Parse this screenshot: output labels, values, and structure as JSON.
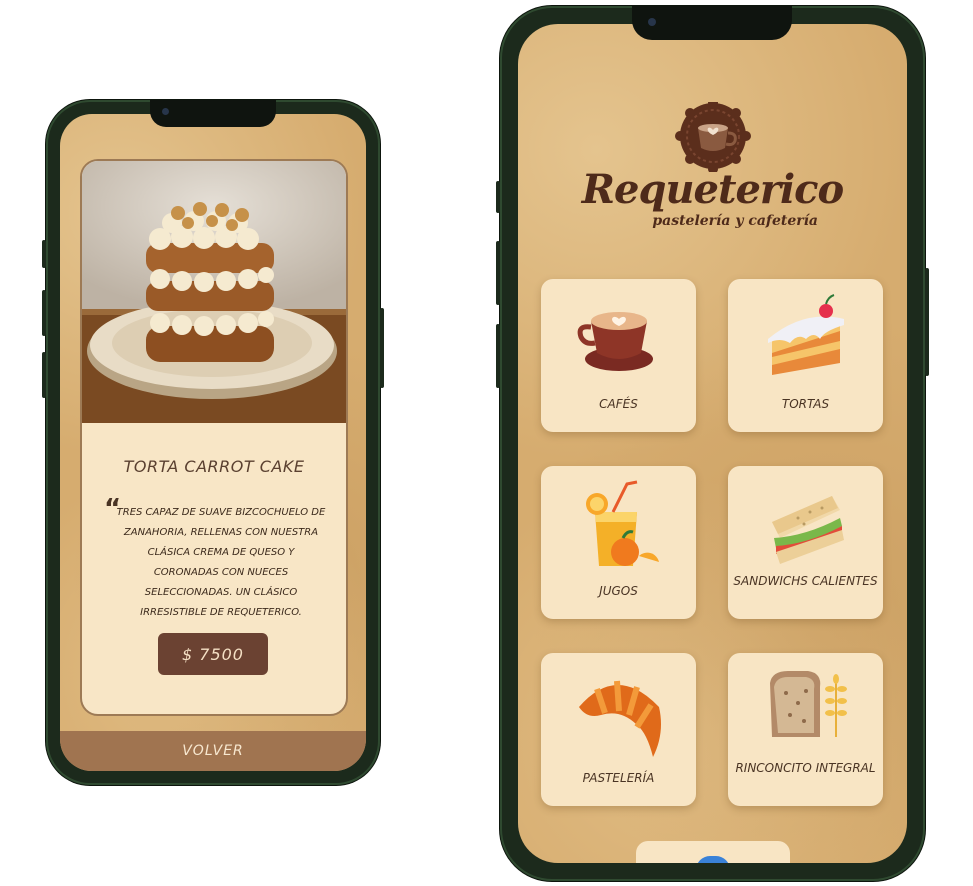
{
  "product_screen": {
    "product_name": "TORTA CARROT CAKE",
    "description": "Tres capaz de suave bizcochuelo de zanahoria, rellenas con nuestra clásica crema de queso y coronadas con nueces seleccionadas. Un clásico irresistible de Requeterico.",
    "price": "$ 7500",
    "back_label": "VOLVER"
  },
  "home_screen": {
    "brand_name": "Requeterico",
    "tagline": "pastelería y cafetería",
    "categories": [
      {
        "label": "CAFÉS",
        "icon": "coffee-cup-icon"
      },
      {
        "label": "TORTAS",
        "icon": "cake-slice-icon"
      },
      {
        "label": "JUGOS",
        "icon": "juice-glass-icon"
      },
      {
        "label": "SANDWICHS CALIENTES",
        "icon": "sandwich-icon"
      },
      {
        "label": "PASTELERÍA",
        "icon": "croissant-icon"
      },
      {
        "label": "RINCONCITO INTEGRAL",
        "icon": "whole-grain-bread-icon"
      }
    ]
  },
  "colors": {
    "paper_background": "#d6ac6f",
    "card_background": "#f8e6c6",
    "price_button": "#6b4232",
    "back_bar": "#a07450",
    "brand_text": "#4e2a1a",
    "phone_frame": "#1c2a1c"
  }
}
